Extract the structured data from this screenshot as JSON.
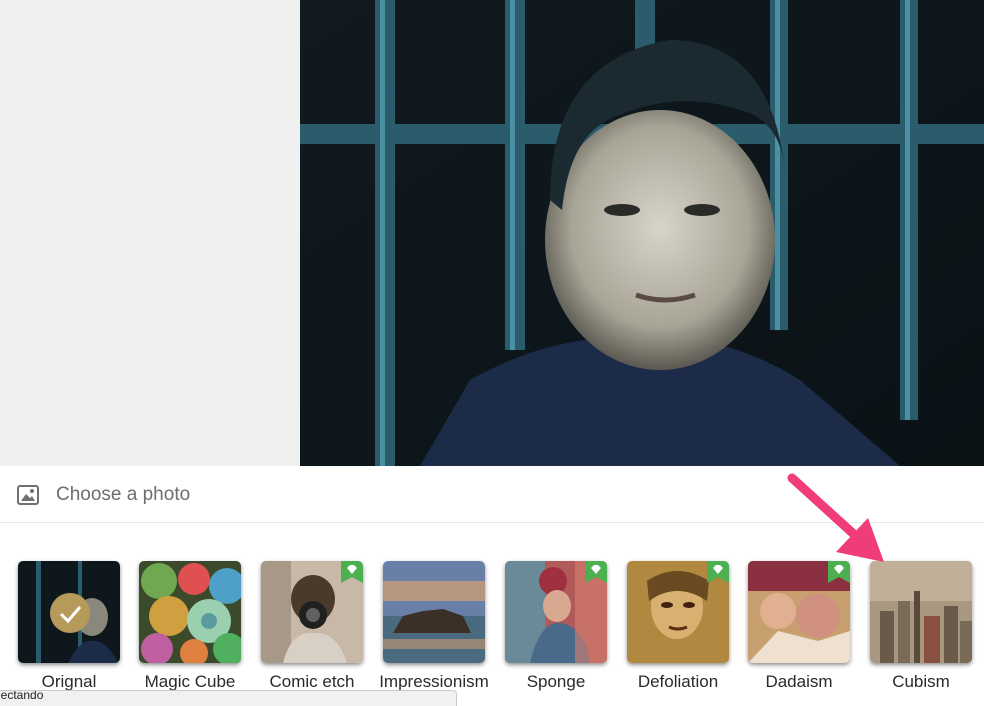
{
  "choose_photo": {
    "icon": "image-icon",
    "label": "Choose a photo"
  },
  "filters": [
    {
      "name": "Orignal",
      "selected": true,
      "premium": false
    },
    {
      "name": "Magic Cube",
      "selected": false,
      "premium": false
    },
    {
      "name": "Comic etch",
      "selected": false,
      "premium": true
    },
    {
      "name": "Impressionism",
      "selected": false,
      "premium": false
    },
    {
      "name": "Sponge",
      "selected": false,
      "premium": true
    },
    {
      "name": "Defoliation",
      "selected": false,
      "premium": true
    },
    {
      "name": "Dadaism",
      "selected": false,
      "premium": true
    },
    {
      "name": "Cubism",
      "selected": false,
      "premium": false
    }
  ],
  "status": {
    "text": "nectando"
  },
  "annotation": {
    "icon": "pointer-arrow-icon",
    "color": "#f03c78"
  },
  "colors": {
    "premium_badge": "#4caf50",
    "check_circle": "#b59a5a"
  }
}
